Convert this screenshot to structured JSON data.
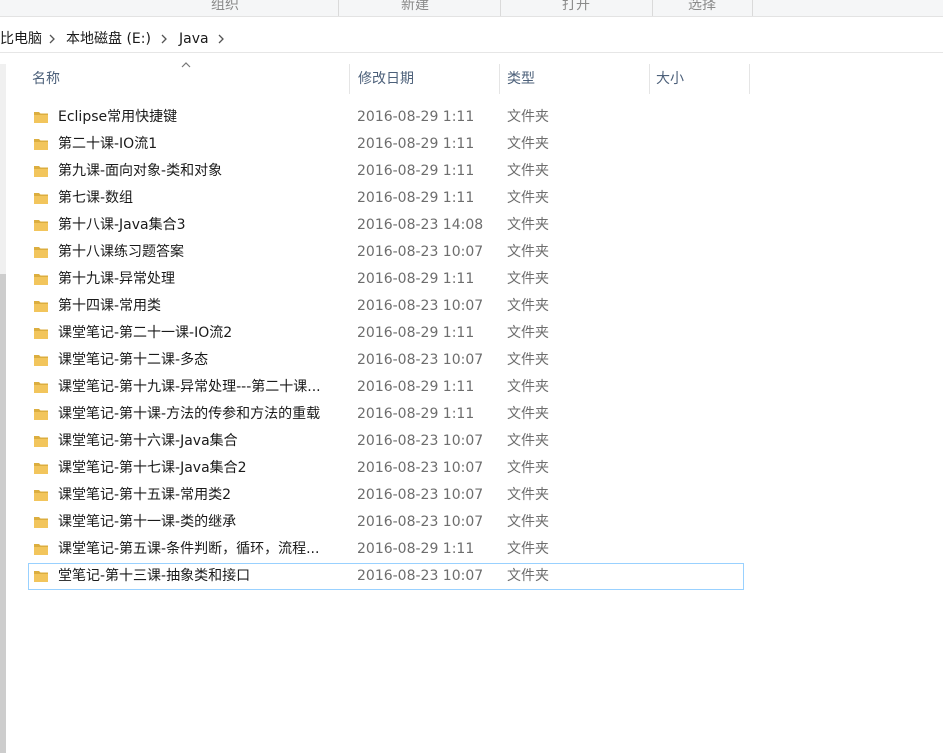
{
  "ribbon": {
    "groups": [
      "组织",
      "新建",
      "打开",
      "选择"
    ]
  },
  "address": {
    "crumbs": [
      "比电脑",
      "本地磁盘 (E:)",
      "Java"
    ]
  },
  "columns": {
    "name": "名称",
    "date": "修改日期",
    "type": "类型",
    "size": "大小"
  },
  "files": [
    {
      "name": "Eclipse常用快捷键",
      "date": "2016-08-29 1:11",
      "type": "文件夹"
    },
    {
      "name": "第二十课-IO流1",
      "date": "2016-08-29 1:11",
      "type": "文件夹"
    },
    {
      "name": "第九课-面向对象-类和对象",
      "date": "2016-08-29 1:11",
      "type": "文件夹"
    },
    {
      "name": "第七课-数组",
      "date": "2016-08-29 1:11",
      "type": "文件夹"
    },
    {
      "name": "第十八课-Java集合3",
      "date": "2016-08-23 14:08",
      "type": "文件夹"
    },
    {
      "name": "第十八课练习题答案",
      "date": "2016-08-23 10:07",
      "type": "文件夹"
    },
    {
      "name": "第十九课-异常处理",
      "date": "2016-08-29 1:11",
      "type": "文件夹"
    },
    {
      "name": "第十四课-常用类",
      "date": "2016-08-23 10:07",
      "type": "文件夹"
    },
    {
      "name": "课堂笔记-第二十一课-IO流2",
      "date": "2016-08-29 1:11",
      "type": "文件夹"
    },
    {
      "name": "课堂笔记-第十二课-多态",
      "date": "2016-08-23 10:07",
      "type": "文件夹"
    },
    {
      "name": "课堂笔记-第十九课-异常处理---第二十课...",
      "date": "2016-08-29 1:11",
      "type": "文件夹"
    },
    {
      "name": "课堂笔记-第十课-方法的传参和方法的重载",
      "date": "2016-08-29 1:11",
      "type": "文件夹"
    },
    {
      "name": "课堂笔记-第十六课-Java集合",
      "date": "2016-08-23 10:07",
      "type": "文件夹"
    },
    {
      "name": "课堂笔记-第十七课-Java集合2",
      "date": "2016-08-23 10:07",
      "type": "文件夹"
    },
    {
      "name": "课堂笔记-第十五课-常用类2",
      "date": "2016-08-23 10:07",
      "type": "文件夹"
    },
    {
      "name": "课堂笔记-第十一课-类的继承",
      "date": "2016-08-23 10:07",
      "type": "文件夹"
    },
    {
      "name": "课堂笔记-第五课-条件判断，循环，流程...",
      "date": "2016-08-29 1:11",
      "type": "文件夹"
    },
    {
      "name": "堂笔记-第十三课-抽象类和接口",
      "date": "2016-08-23 10:07",
      "type": "文件夹",
      "selected": true
    }
  ],
  "colors": {
    "folder": "#f2c55c",
    "folder_dark": "#dcae3f",
    "header_text": "#4c607a",
    "selection_border": "#99d1ff"
  }
}
